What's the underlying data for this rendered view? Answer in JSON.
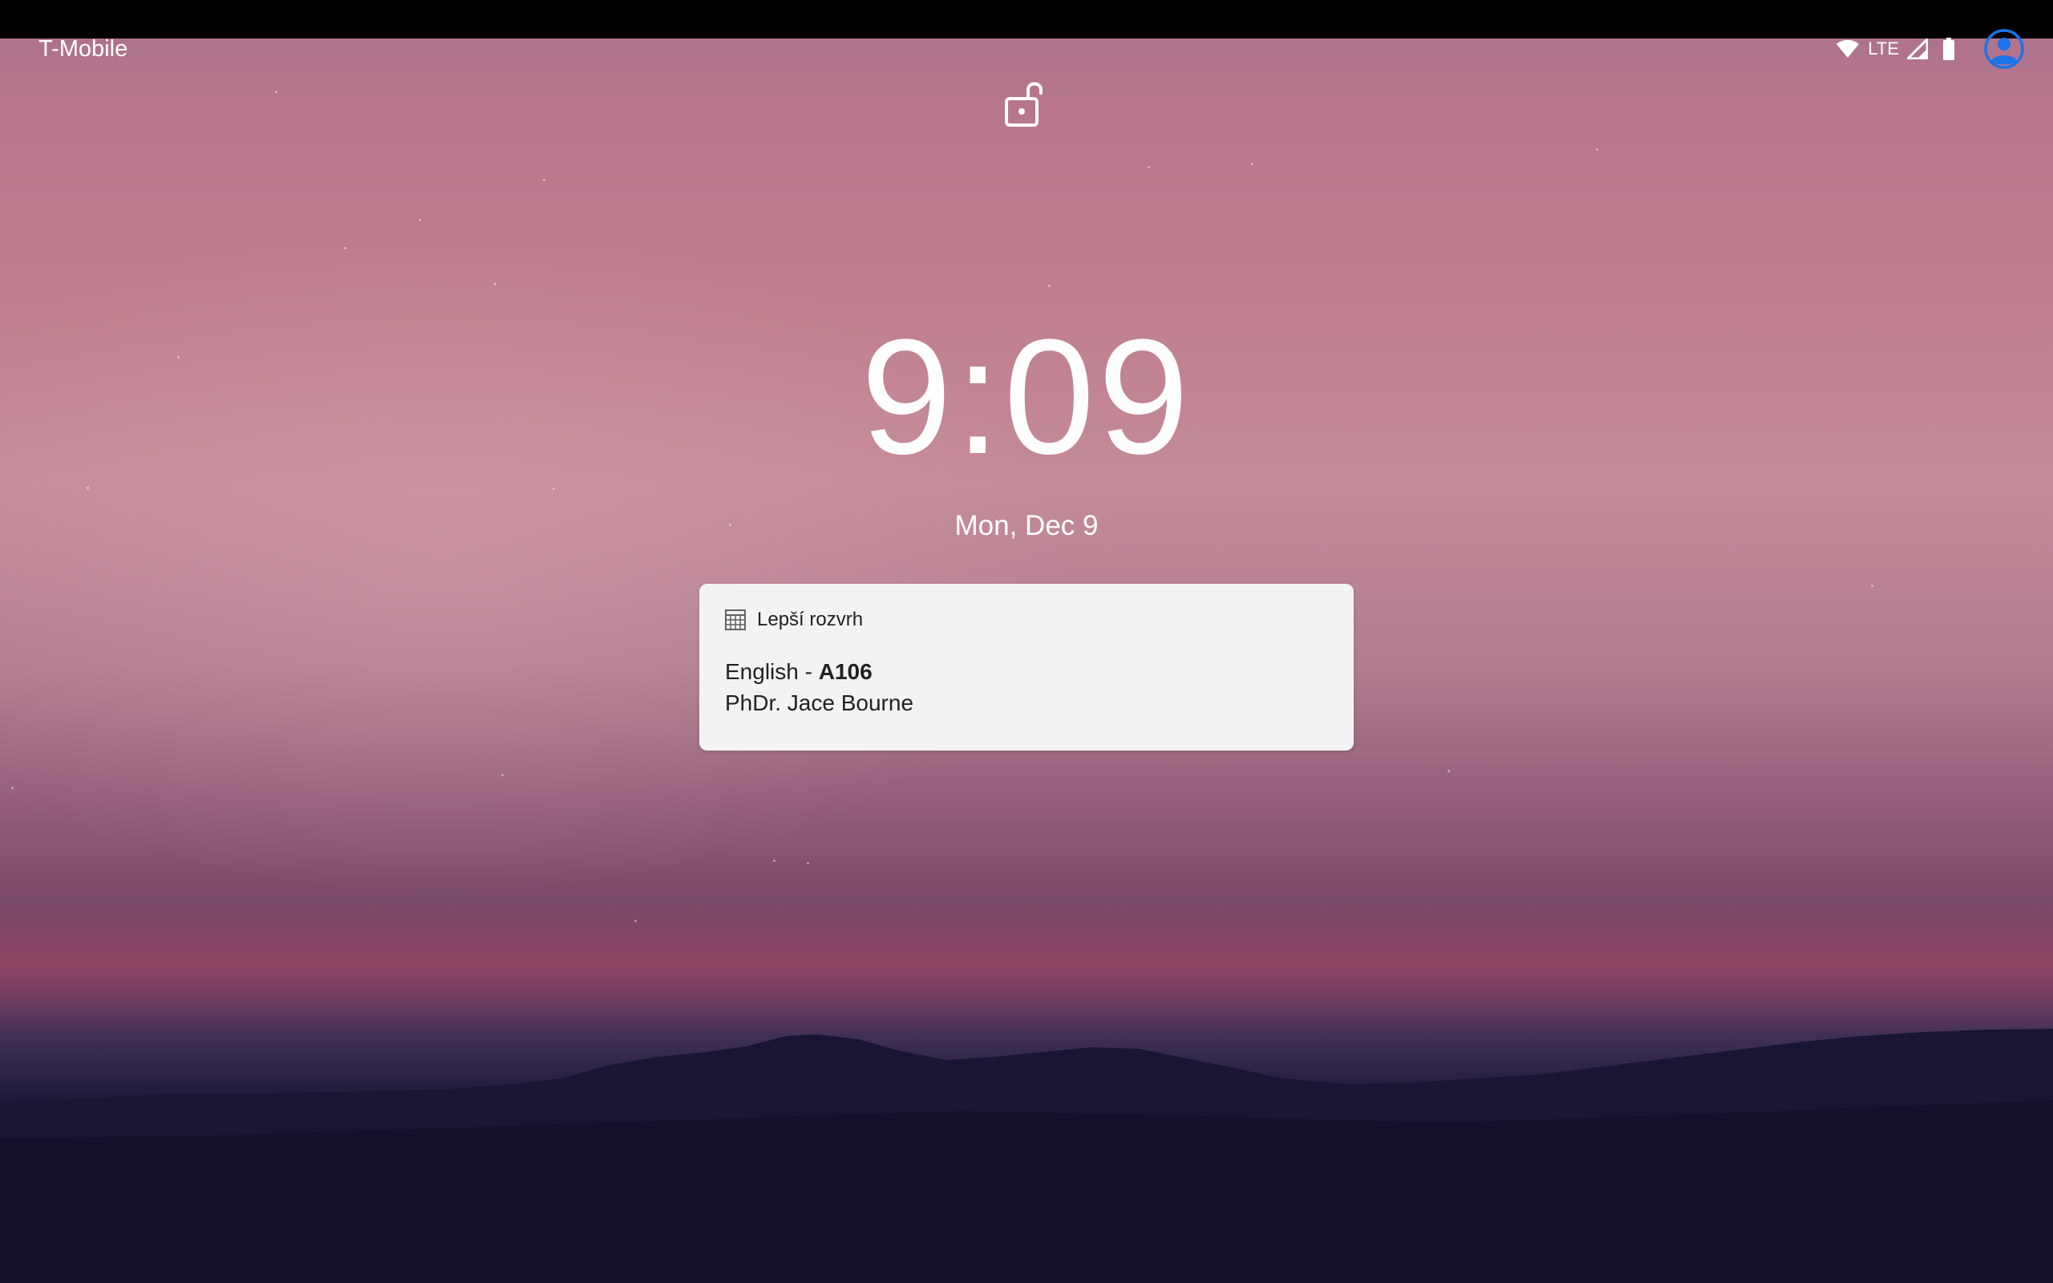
{
  "status_bar": {
    "carrier": "T-Mobile",
    "network_type": "LTE",
    "icons": [
      "wifi-icon",
      "cell-signal-icon",
      "battery-icon",
      "user-avatar-icon"
    ],
    "avatar_color": "#1a73e8"
  },
  "lockscreen": {
    "lock_icon": "unlocked-padlock-icon",
    "time": "9:09",
    "date": "Mon, Dec 9"
  },
  "notification": {
    "app_icon": "calendar-grid-icon",
    "app_name": "Lepší rozvrh",
    "title_prefix": "English - ",
    "title_bold": "A106",
    "text": "PhDr. Jace Bourne",
    "background": "#f3f3f3"
  }
}
